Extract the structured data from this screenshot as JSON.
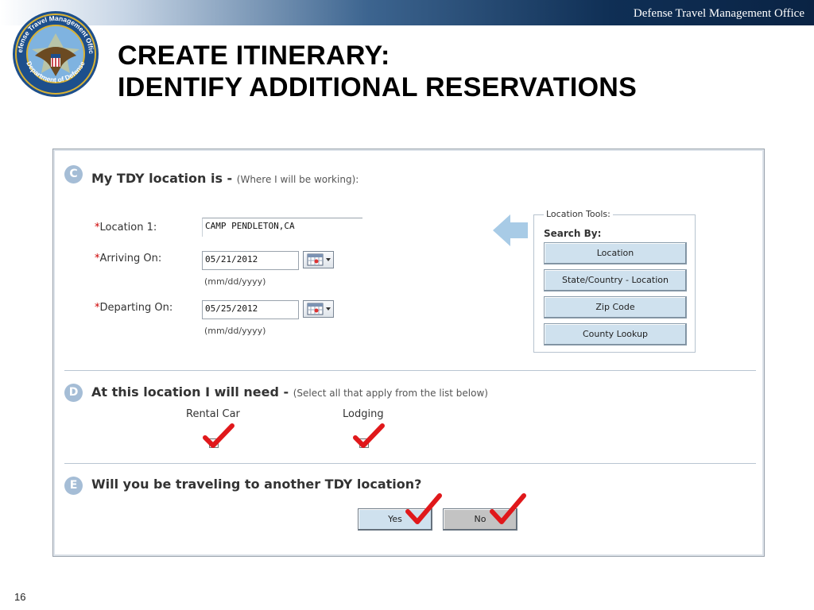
{
  "header": {
    "org_name": "Defense Travel Management Office"
  },
  "seal": {
    "text": "Defense Travel Management Office · Department of Defense"
  },
  "slide": {
    "title_line1": "CREATE ITINERARY:",
    "title_line2": "IDENTIFY ADDITIONAL RESERVATIONS",
    "page_number": "16"
  },
  "section_c": {
    "badge": "C",
    "title": "My TDY location is",
    "dash": "-",
    "subtitle": "(Where I will be working):",
    "location": {
      "required_mark": "*",
      "label": "Location 1:",
      "value": "CAMP PENDLETON,CA"
    },
    "arriving": {
      "required_mark": "*",
      "label": "Arriving On:",
      "value": "05/21/2012",
      "hint": "(mm/dd/yyyy)"
    },
    "departing": {
      "required_mark": "*",
      "label": "Departing On:",
      "value": "05/25/2012",
      "hint": "(mm/dd/yyyy)"
    },
    "tools": {
      "legend": "Location Tools:",
      "heading": "Search By:",
      "buttons": [
        "Location",
        "State/Country - Location",
        "Zip Code",
        "County Lookup"
      ]
    }
  },
  "section_d": {
    "badge": "D",
    "title": "At this location I will need",
    "dash": "-",
    "subtitle": "(Select all that apply from the list below)",
    "options": [
      {
        "label": "Rental Car",
        "checked": true
      },
      {
        "label": "Lodging",
        "checked": true
      }
    ]
  },
  "section_e": {
    "badge": "E",
    "title": "Will you be traveling to another TDY location?",
    "yes_label": "Yes",
    "no_label": "No"
  },
  "colors": {
    "checkmark": "#e0181b",
    "badge": "#a5bdd6",
    "tool_button": "#cfe1ee",
    "no_button": "#c3c3c3"
  }
}
